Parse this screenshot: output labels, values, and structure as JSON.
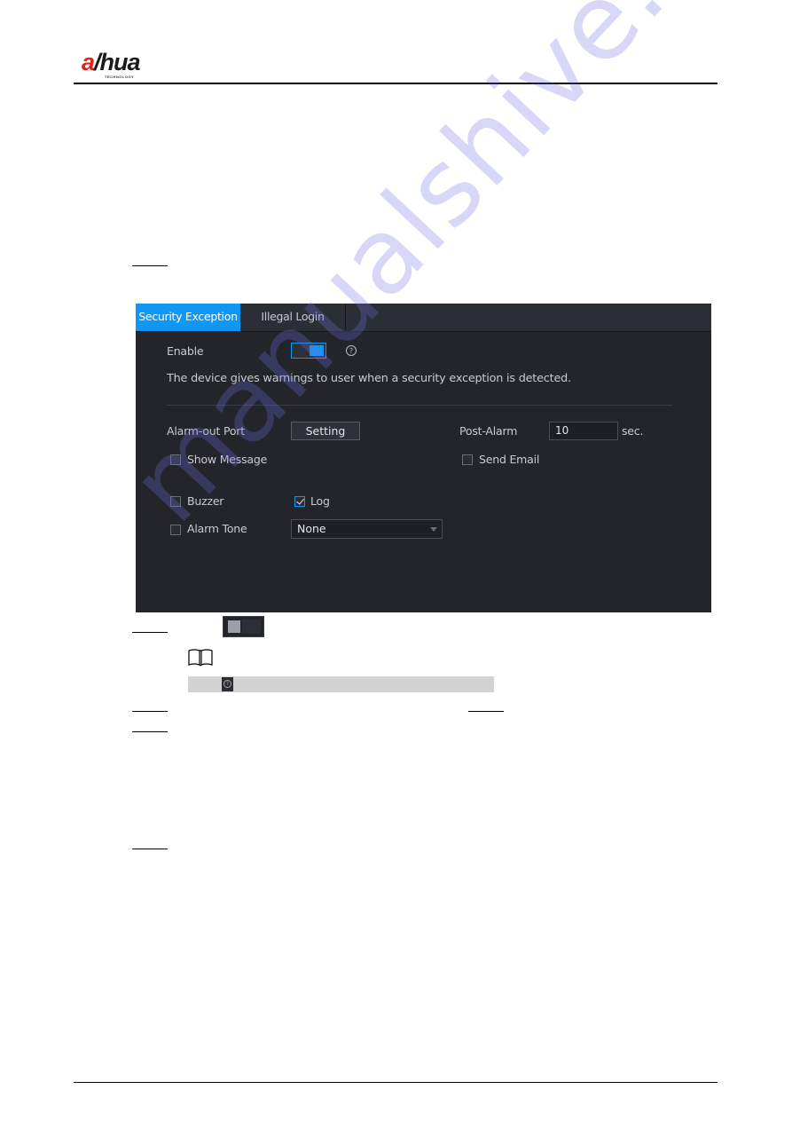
{
  "header": {
    "logo_text_a": "a",
    "logo_text_rest": "hua",
    "logo_sub": "TECHNOLOGY"
  },
  "panel": {
    "tabs": [
      {
        "label": "Security Exception",
        "active": true
      },
      {
        "label": "Illegal Login",
        "active": false
      }
    ],
    "enable_label": "Enable",
    "enable_on": true,
    "help_glyph": "?",
    "description": "The device gives warnings to user when a security exception is detected.",
    "alarm_out_label": "Alarm-out Port",
    "setting_button": "Setting",
    "post_alarm_label": "Post-Alarm",
    "post_alarm_value": "10",
    "post_alarm_unit": "sec.",
    "checkboxes": {
      "show_message": {
        "label": "Show Message",
        "checked": false
      },
      "send_email": {
        "label": "Send Email",
        "checked": false
      },
      "buzzer": {
        "label": "Buzzer",
        "checked": false
      },
      "log": {
        "label": "Log",
        "checked": true
      },
      "alarm_tone": {
        "label": "Alarm Tone",
        "checked": false
      }
    },
    "alarm_tone_select": "None"
  },
  "note": {
    "help_glyph": "?"
  },
  "watermark": "manualshive.com"
}
